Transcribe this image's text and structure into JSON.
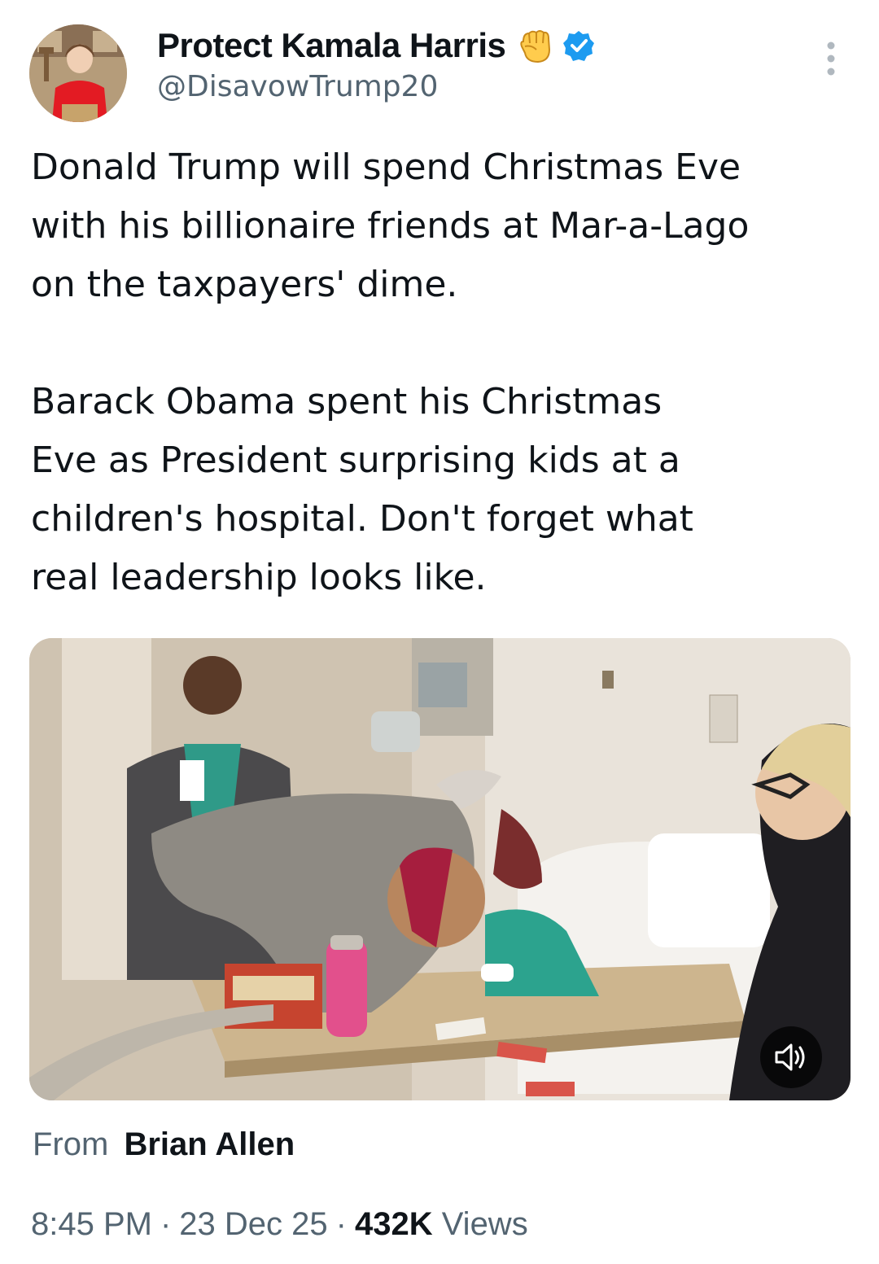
{
  "header": {
    "display_name": "Protect Kamala Harris",
    "handle": "@DisavowTrump20",
    "icons": {
      "badge_emoji": "raised-fist-icon",
      "verified": "verified-badge-icon",
      "menu": "more-vertical-icon"
    }
  },
  "tweet": {
    "paragraph_1": "Donald Trump will spend Christmas Eve\nwith his billionaire friends at Mar-a-Lago\non the taxpayers' dime.",
    "paragraph_2": "Barack Obama spent his Christmas\nEve as President surprising kids at a\nchildren's hospital. Don't forget what\nreal leadership looks like."
  },
  "media": {
    "type": "video",
    "mute_icon": "speaker-icon"
  },
  "attribution": {
    "prefix": "From",
    "author": "Brian Allen"
  },
  "meta": {
    "time": "8:45 PM",
    "date": "23 Dec 25",
    "separator": "·",
    "views_count": "432K",
    "views_label": "Views"
  },
  "colors": {
    "text_primary": "#0f1419",
    "text_secondary": "#536471",
    "verified_blue": "#1d9bf0",
    "fist_yellow": "#ffcc4d"
  }
}
